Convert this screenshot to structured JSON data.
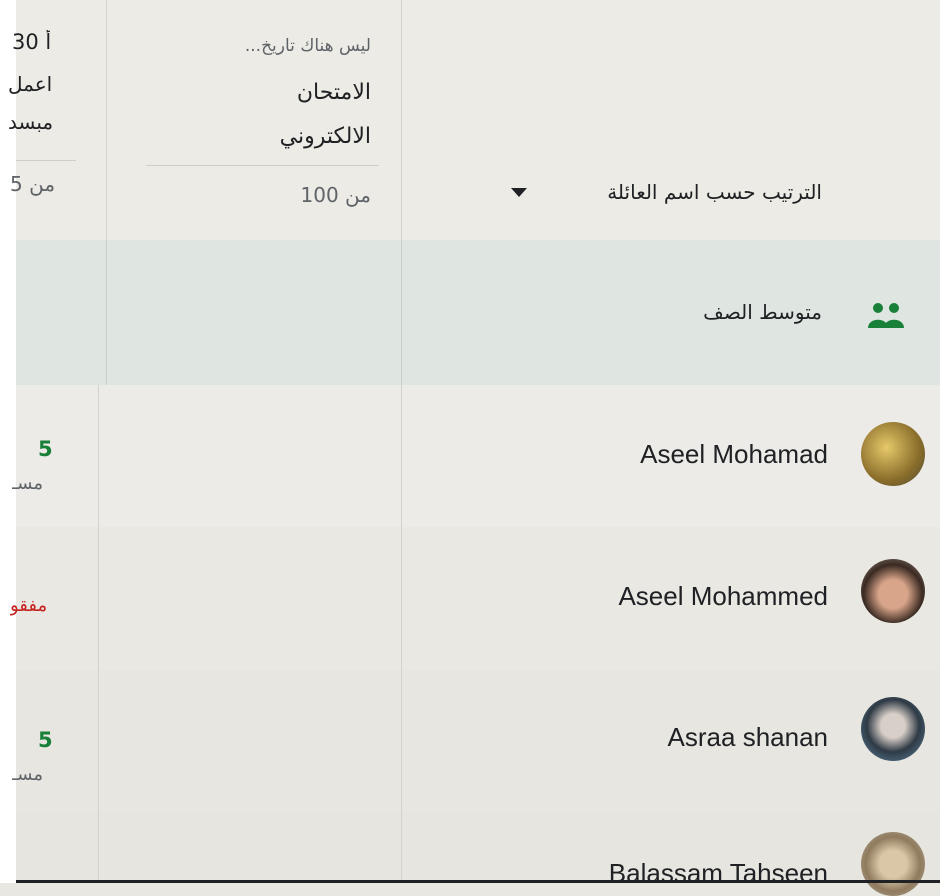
{
  "header": {
    "assignment_right": {
      "due": "ليس هناك تاريخ...",
      "title_line1": "الامتحان",
      "title_line2": "الالكتروني",
      "points": "من 100"
    },
    "assignment_left": {
      "due": "30 أ",
      "title_line1": "اعمل",
      "title_line2": "مبسد",
      "points": "من 5"
    },
    "sort_label": "الترتيب حسب اسم العائلة"
  },
  "class_average": {
    "label": "متوسط الصف"
  },
  "students": [
    {
      "name": "Aseel Mohamad",
      "left_grade": "5",
      "left_sub": "مسـ",
      "left_status": ""
    },
    {
      "name": "Aseel Mohammed",
      "left_grade": "",
      "left_sub": "",
      "left_status": "مفقو"
    },
    {
      "name": "Asraa shanan",
      "left_grade": "5",
      "left_sub": "مسـ",
      "left_status": ""
    },
    {
      "name": "Balassam Tahseen",
      "left_grade": "",
      "left_sub": "",
      "left_status": ""
    }
  ],
  "colors": {
    "accent_green": "#188038",
    "missing_red": "#c5221f"
  }
}
